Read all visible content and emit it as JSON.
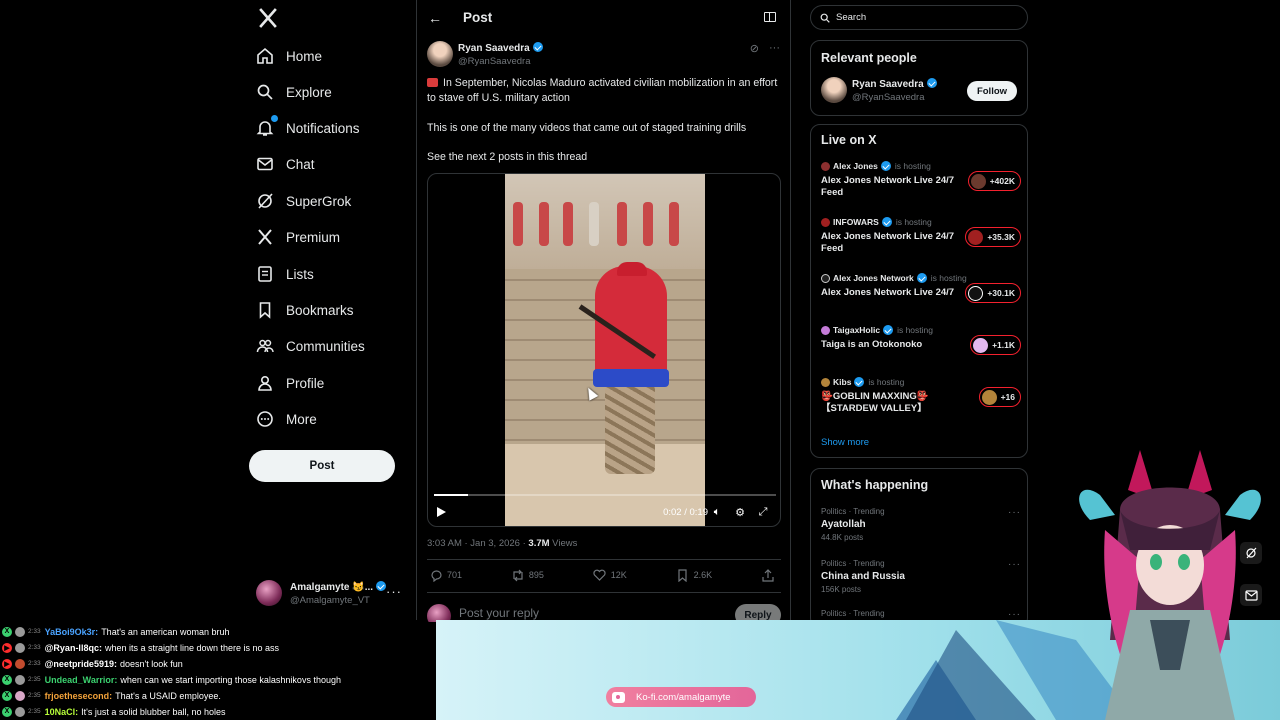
{
  "nav": {
    "logo": "x-logo-icon",
    "items": [
      {
        "label": "Home",
        "icon": "home-icon"
      },
      {
        "label": "Explore",
        "icon": "search-icon"
      },
      {
        "label": "Notifications",
        "icon": "bell-icon"
      },
      {
        "label": "Chat",
        "icon": "mail-icon"
      },
      {
        "label": "SuperGrok",
        "icon": "grok-icon"
      },
      {
        "label": "Premium",
        "icon": "x-icon"
      },
      {
        "label": "Lists",
        "icon": "list-icon"
      },
      {
        "label": "Bookmarks",
        "icon": "bookmark-icon"
      },
      {
        "label": "Communities",
        "icon": "people-icon"
      },
      {
        "label": "Profile",
        "icon": "person-icon"
      },
      {
        "label": "More",
        "icon": "more-circle-icon"
      }
    ],
    "post_label": "Post",
    "account": {
      "name": "Amalgamyte 😼...",
      "handle": "@Amalgamyte_VT"
    }
  },
  "header": {
    "title": "Post"
  },
  "post": {
    "author_name": "Ryan Saavedra",
    "author_handle": "@RyanSaavedra",
    "text_1": "In September, Nicolas Maduro activated civilian mobilization in an effort to stave off U.S. military action",
    "text_2": "This is one of the many videos that came out of staged training drills",
    "text_3": "See the next 2 posts in this thread",
    "video": {
      "time": "0:02 / 0:19",
      "progress": 0.1
    },
    "time": "3:03 AM · Jan 3, 2026 ·",
    "views_count": "3.7M",
    "views_label": "Views",
    "replies": "701",
    "reposts": "895",
    "likes": "12K",
    "bookmarks": "2.6K",
    "reply_placeholder": "Post your reply",
    "reply_button": "Reply"
  },
  "search": {
    "placeholder": "Search"
  },
  "relevant": {
    "title": "Relevant people",
    "name": "Ryan Saavedra",
    "handle": "@RyanSaavedra",
    "follow": "Follow"
  },
  "live": {
    "title": "Live on X",
    "hosting": "is hosting",
    "items": [
      {
        "host": "Alex Jones",
        "title": "Alex Jones Network Live 24/7 Feed",
        "count": "+402K",
        "color": "#8b2f2f"
      },
      {
        "host": "INFOWARS",
        "title": "Alex Jones Network Live 24/7 Feed",
        "count": "+35.3K",
        "color": "#a12020"
      },
      {
        "host": "Alex Jones Network",
        "title": "Alex Jones Network Live 24/7",
        "count": "+30.1K",
        "color": "#222222"
      },
      {
        "host": "TaigaxHolic",
        "title": "Taiga is an Otokonoko",
        "count": "+1.1K",
        "color": "#c47bd8"
      },
      {
        "host": "Kibs",
        "title": "👺GOBLIN MAXXING👺【STARDEW VALLEY】",
        "count": "+16",
        "color": "#b3843a"
      }
    ],
    "show_more": "Show more"
  },
  "trends": {
    "title": "What's happening",
    "items": [
      {
        "category": "Politics · Trending",
        "name": "Ayatollah",
        "count": "44.8K posts"
      },
      {
        "category": "Politics · Trending",
        "name": "China and Russia",
        "count": "156K posts"
      },
      {
        "category": "Politics · Trending",
        "name": "",
        "count": ""
      }
    ]
  },
  "chat": [
    {
      "platform": "x",
      "time": "2:33",
      "user": "YaBoi9Ok3r:",
      "msg": "That's an american woman bruh",
      "color": "#4aa3ff"
    },
    {
      "platform": "yt",
      "time": "2:33",
      "user": "@Ryan-ll8qc:",
      "msg": "when its a straight line down there is no ass",
      "color": "#ffffff"
    },
    {
      "platform": "yt",
      "time": "2:33",
      "user": "@neetpride5919:",
      "msg": "doesn't look fun",
      "color": "#ffffff"
    },
    {
      "platform": "x",
      "time": "2:35",
      "user": "Undead_Warrior:",
      "msg": "when can we start importing those kalashnikovs though",
      "color": "#3bd16f"
    },
    {
      "platform": "x",
      "time": "2:35",
      "user": "frjoethesecond:",
      "msg": "That's a USAID employee.",
      "color": "#f2a23a"
    },
    {
      "platform": "x",
      "time": "2:35",
      "user": "10NaCl:",
      "msg": "It's just a solid blubber ball, no holes",
      "color": "#b8ff3a"
    }
  ],
  "kofi": {
    "label": "Ko-fi.com/amalgamyte"
  }
}
